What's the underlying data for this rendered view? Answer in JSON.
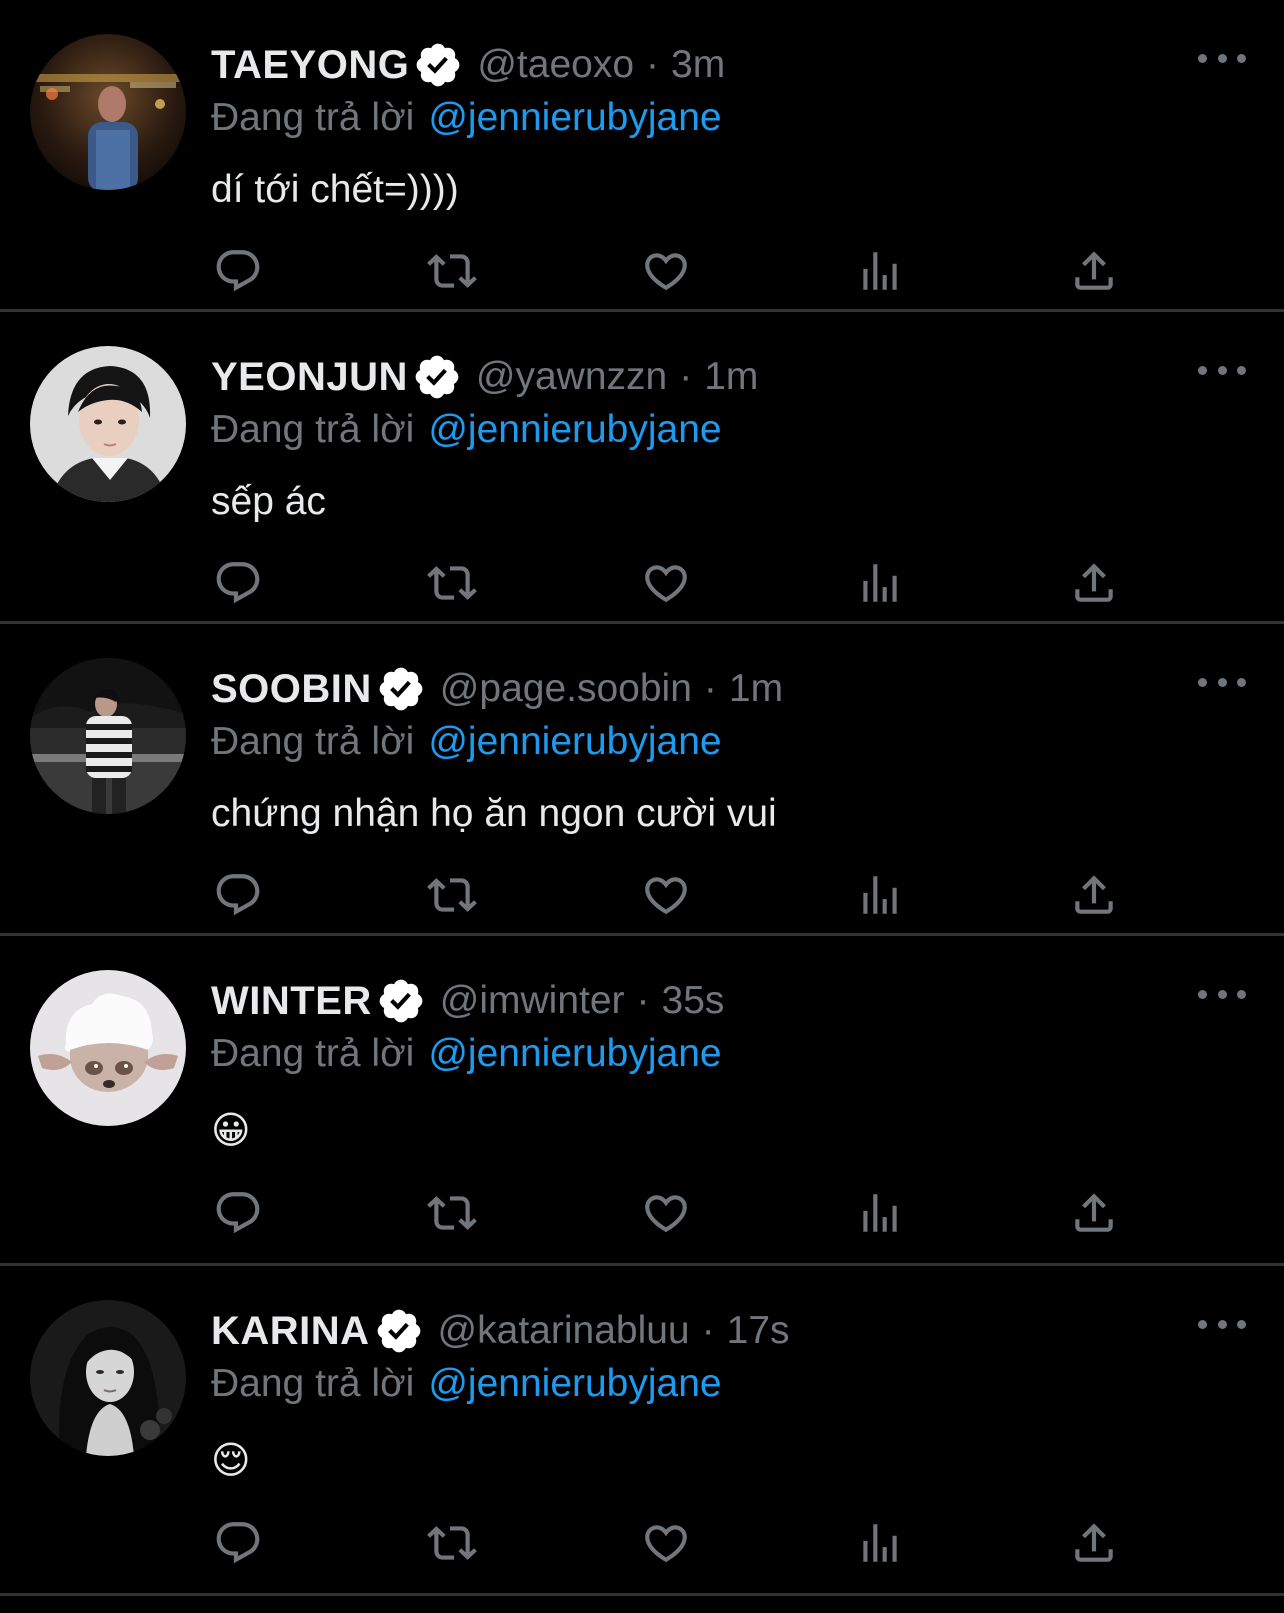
{
  "reply_prefix": "Đang trả lời",
  "reply_target": "@jennierubyjane",
  "tweets": [
    {
      "display_name": "TAEYONG",
      "handle": "@taeoxo",
      "time": "3m",
      "text": "dí tới chết=))))"
    },
    {
      "display_name": "YEONJUN",
      "handle": "@yawnzzn",
      "time": "1m",
      "text": "sếp ác"
    },
    {
      "display_name": "SOOBIN",
      "handle": "@page.soobin",
      "time": "1m",
      "text": "chứng nhận họ ăn ngon cười vui"
    },
    {
      "display_name": "WINTER",
      "handle": "@imwinter",
      "time": "35s",
      "text": "😀"
    },
    {
      "display_name": "KARINA",
      "handle": "@katarinabluu",
      "time": "17s",
      "text": "😌"
    }
  ],
  "separator": "·",
  "icons": {
    "verified": "verified-badge-icon",
    "reply": "reply-icon",
    "retweet": "retweet-icon",
    "like": "like-icon",
    "views": "views-icon",
    "share": "share-icon",
    "more": "more-icon"
  },
  "colors": {
    "background": "#000000",
    "primary_text": "#e7e9ea",
    "secondary_text": "#71767b",
    "link": "#1d9bf0",
    "divider": "#2f3336"
  }
}
